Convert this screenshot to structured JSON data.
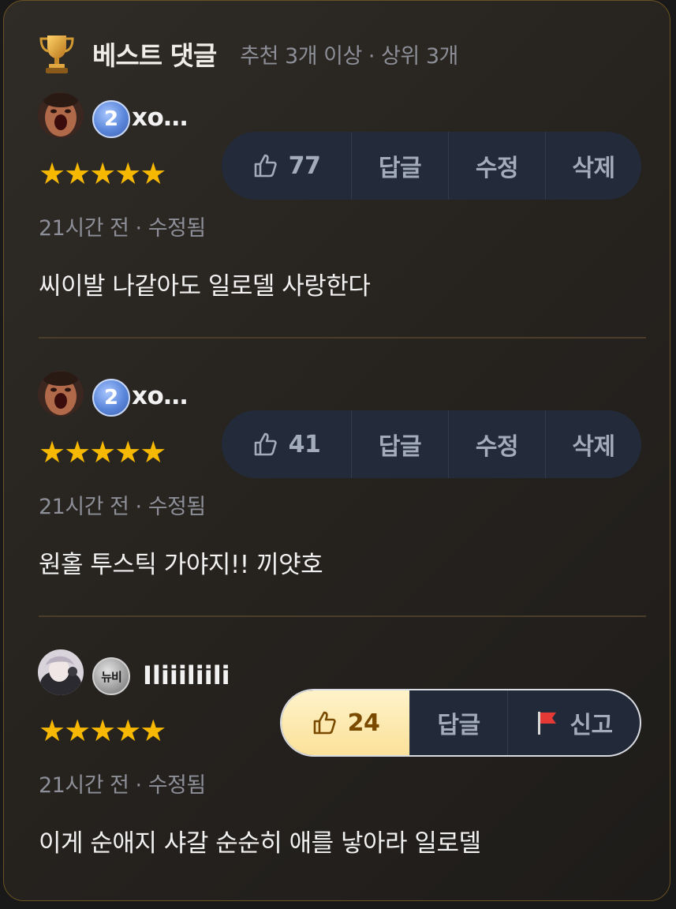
{
  "header": {
    "title": "베스트 댓글",
    "subtitle": "추천 3개 이상 · 상위 3개",
    "icon": "trophy-icon"
  },
  "comments": [
    {
      "avatar": "user-avatar",
      "badge": "2",
      "username": "xo…",
      "stars": "★★★★★",
      "meta": "21시간 전 · 수정됨",
      "text": "씨이발 나같아도 일로델 사랑한다",
      "likes": "77",
      "reply_label": "답글",
      "edit_label": "수정",
      "delete_label": "삭제"
    },
    {
      "avatar": "user-avatar",
      "badge": "2",
      "username": "xo…",
      "stars": "★★★★★",
      "meta": "21시간 전 · 수정됨",
      "text": "원홀 투스틱 가야지!! 끼얏호",
      "likes": "41",
      "reply_label": "답글",
      "edit_label": "수정",
      "delete_label": "삭제"
    },
    {
      "avatar": "user-avatar",
      "badge": "뉴비",
      "username": "Iliiiliili",
      "stars": "★★★★★",
      "meta": "21시간 전 · 수정됨",
      "text": "이게 순애지 샤갈 순순히 애를 낳아라 일로델",
      "likes": "24",
      "liked": true,
      "reply_label": "답글",
      "report_label": "신고"
    }
  ],
  "colors": {
    "star": "#f6b800",
    "border": "#6a5222",
    "action_bg": "#232b3a",
    "liked_bg": "#fbe19a"
  }
}
